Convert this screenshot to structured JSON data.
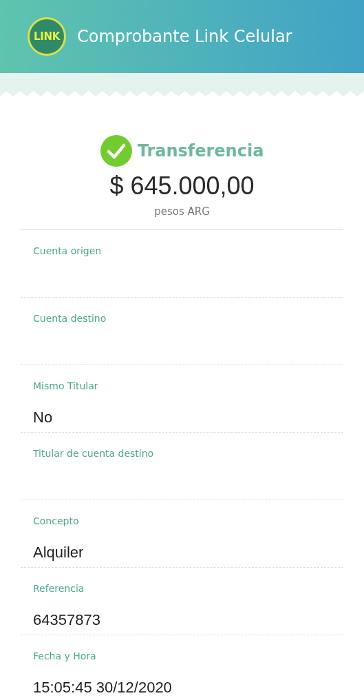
{
  "header": {
    "logo_text": "LINK",
    "title": "Comprobante Link Celular"
  },
  "summary": {
    "type": "Transferencia",
    "amount": "$ 645.000,00",
    "currency": "pesos ARG"
  },
  "fields": [
    {
      "label": "Cuenta origen"
    },
    {
      "label": "Cuenta destino"
    },
    {
      "label": "Mismo Titular",
      "value": "No"
    },
    {
      "label": "Titular de cuenta destino"
    },
    {
      "label": "Concepto",
      "value": "Alquiler"
    },
    {
      "label": "Referencia",
      "value": "64357873"
    },
    {
      "label": "Fecha y Hora",
      "value": "15:05:45 30/12/2020"
    }
  ]
}
